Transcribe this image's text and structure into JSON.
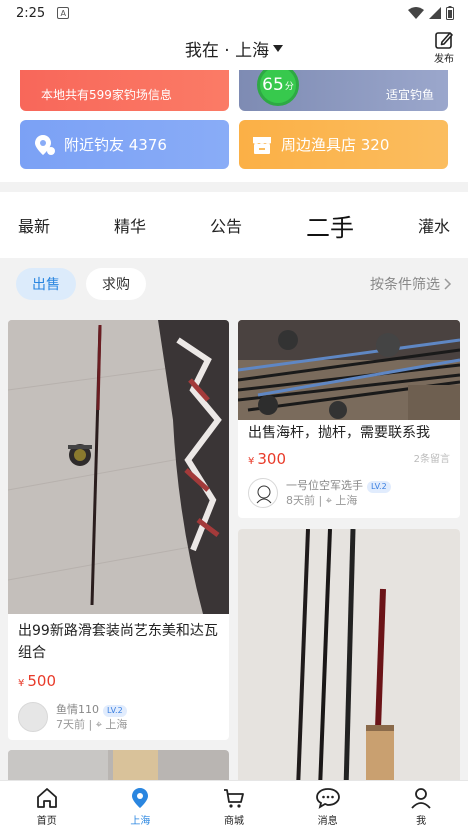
{
  "status": {
    "time": "2:25",
    "notif_letter": "A"
  },
  "header": {
    "location": "我在 · 上海",
    "publish_label": "发布"
  },
  "cards": {
    "spots": "本地共有599家钓场信息",
    "score_value": "65",
    "score_unit": "分",
    "weather": "适宜钓鱼",
    "friends": "附近钓友 4376",
    "shops": "周边渔具店 320"
  },
  "tabs": [
    "最新",
    "精华",
    "公告",
    "二手",
    "灌水"
  ],
  "active_tab": "二手",
  "subbar": {
    "sell": "出售",
    "buy": "求购",
    "filter": "按条件筛选"
  },
  "posts": [
    {
      "title": "出99新路滑套装尚艺东美和达瓦组合",
      "price": "500",
      "currency": "¥",
      "user": "鱼情110",
      "level": "LV.2",
      "time": "7天前",
      "city": "上海"
    },
    {
      "title": "出售海杆，抛杆，需要联系我",
      "price": "300",
      "currency": "¥",
      "comments": "2条留言",
      "user": "一号位空军选手",
      "level": "LV.2",
      "time": "8天前",
      "city": "上海"
    }
  ],
  "nav": [
    "首页",
    "上海",
    "商城",
    "消息",
    "我"
  ],
  "colors": {
    "accent": "#2a86e0",
    "price": "#e83b2a"
  }
}
